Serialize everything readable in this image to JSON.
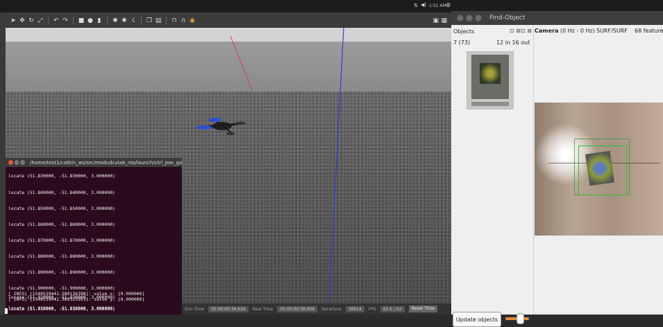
{
  "find_object": {
    "title": "Find-Object",
    "objects_label": "Objects",
    "objects_count": "7 (73)",
    "objects_inout": "12 in 16 out",
    "camera_label": "Camera",
    "camera_rate": "(0 Hz - 0 Hz)",
    "method": "SURF/SURF",
    "features": "68 feature",
    "update_button": "Update objects"
  },
  "terminal": {
    "title": "/home/test1/catkin_ws/src/modudculab_ros/launch/ctrl_pos_gazel",
    "lines": [
      "locate (51.830000, -51.830000, 3.000000)",
      "locate (51.840000, -51.840000, 3.000000)",
      "locate (51.850000, -51.850000, 3.000000)",
      "locate (51.860000, -51.860000, 3.000000)",
      "locate (51.870000, -51.870000, 3.000000)",
      "locate (51.880000, -51.880000, 3.000000)",
      "locate (51.890000, -51.890000, 3.000000)",
      "locate (51.900000, -51.900000, 3.000000)",
      "[ INFO] [1540539441.589136398]: value x: [0.000000]",
      "[ INFO] [1540539441.589325993]: value y: [0.000000]",
      "locate (51.910000, -51.910000, 3.000000)",
      "locate (51.920000, -51.920000, 3.000000)",
      "locate (51.930000, -51.930000, 3.000000)"
    ]
  },
  "gazebo_status": {
    "sim_time_label": "Sim Time",
    "sim_time": "00 00:00:36.626",
    "real_time_label": "Real Time",
    "real_time": "00 00:00:38.906",
    "iterations_label": "Iterations",
    "iterations": "36614",
    "fps_label": "FPS",
    "fps": "62.5 / 62",
    "reset_button": "Reset Time"
  },
  "top_panel": {
    "time": "1:51 AM"
  },
  "colors": {
    "terminal_bg": "#2c0a1e",
    "slider": "#e08d3c",
    "detection_box": "#2fbf2f"
  }
}
